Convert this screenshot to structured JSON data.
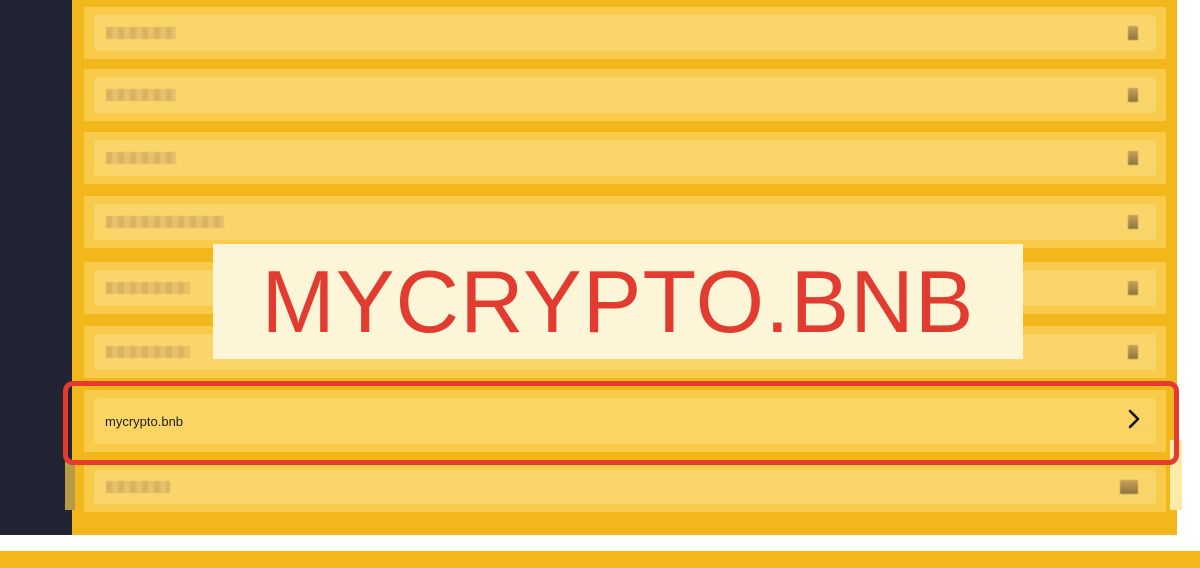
{
  "overlay": {
    "banner_text": "MYCRYPTO.BNB"
  },
  "list": {
    "rows": [
      {
        "label": "",
        "blurred": true
      },
      {
        "label": "",
        "blurred": true
      },
      {
        "label": "",
        "blurred": true
      },
      {
        "label": "",
        "blurred": true
      },
      {
        "label": "",
        "blurred": true
      },
      {
        "label": "",
        "blurred": true
      },
      {
        "label": "mycrypto.bnb",
        "blurred": false,
        "highlighted": true
      },
      {
        "label": "",
        "blurred": true
      }
    ],
    "active_label": "mycrypto.bnb",
    "chevron_icon": "chevron-right-icon"
  },
  "colors": {
    "sidebar": "#222433",
    "panel": "#f2b71a",
    "row": "#fad56a",
    "highlight_border": "#e53a2f",
    "banner_text": "#e23b30",
    "banner_bg": "#fdf5d8"
  }
}
